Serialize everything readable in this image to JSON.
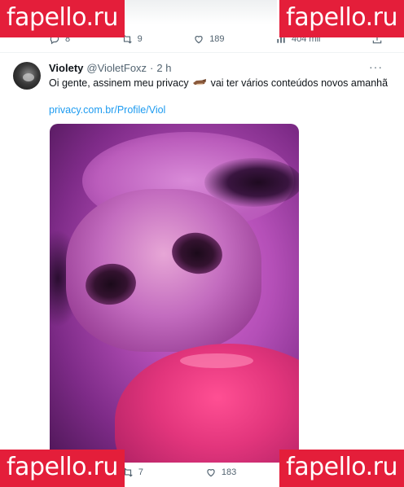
{
  "previous_tweet": {
    "actions": {
      "replies": "8",
      "retweets": "9",
      "likes": "189",
      "views": "404 mil"
    }
  },
  "tweet": {
    "author_name": "Violety",
    "handle": "@VioletFoxz",
    "separator": "·",
    "time": "2 h",
    "more_label": "···",
    "text_before": "Oi gente, assinem meu privacy",
    "text_after": "vai ter vários conteúdos novos amanhã",
    "emoji_icon": "fox-emoji-icon",
    "link": "privacy.com.br/Profile/Viol",
    "actions": {
      "retweets": "7",
      "likes": "183"
    }
  },
  "watermark": {
    "text": "fapello.ru",
    "color": "#e41e3a"
  },
  "colors": {
    "link": "#1d9bf0",
    "secondary_text": "#536471"
  }
}
